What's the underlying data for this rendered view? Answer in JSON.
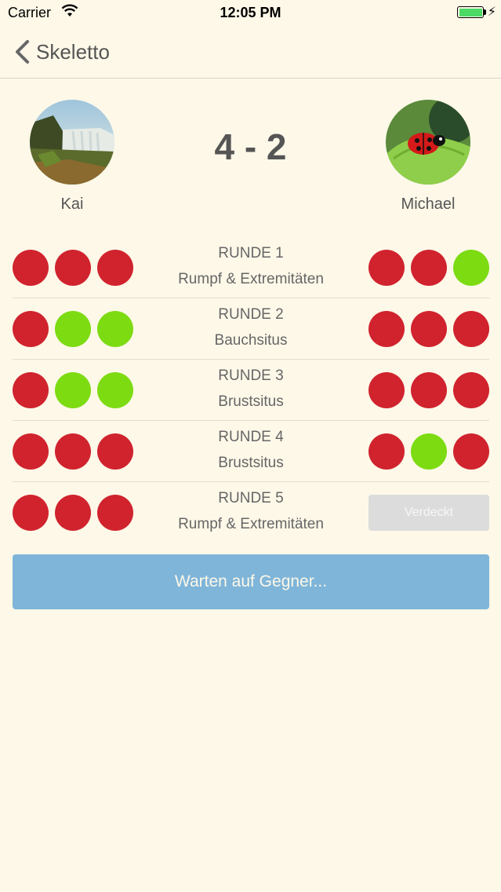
{
  "status_bar": {
    "carrier": "Carrier",
    "time": "12:05 PM",
    "battery_color": "#4cd964"
  },
  "nav": {
    "back_label": "Skeletto"
  },
  "match": {
    "player_left": "Kai",
    "player_right": "Michael",
    "score": "4 - 2"
  },
  "rounds": [
    {
      "title": "RUNDE 1",
      "category": "Rumpf & Extremitäten",
      "left": [
        "red",
        "red",
        "red"
      ],
      "right": [
        "red",
        "red",
        "green"
      ]
    },
    {
      "title": "RUNDE 2",
      "category": "Bauchsitus",
      "left": [
        "red",
        "green",
        "green"
      ],
      "right": [
        "red",
        "red",
        "red"
      ]
    },
    {
      "title": "RUNDE 3",
      "category": "Brustsitus",
      "left": [
        "red",
        "green",
        "green"
      ],
      "right": [
        "red",
        "red",
        "red"
      ]
    },
    {
      "title": "RUNDE 4",
      "category": "Brustsitus",
      "left": [
        "red",
        "red",
        "red"
      ],
      "right": [
        "red",
        "green",
        "red"
      ]
    },
    {
      "title": "RUNDE 5",
      "category": "Rumpf & Extremitäten",
      "left": [
        "red",
        "red",
        "red"
      ],
      "right_hidden_label": "Verdeckt"
    }
  ],
  "wait_button_label": "Warten auf Gegner...",
  "colors": {
    "background": "#fdf8e8",
    "wrong": "#d0232e",
    "correct": "#7ddb12",
    "wait_button": "#7fb5d9"
  }
}
